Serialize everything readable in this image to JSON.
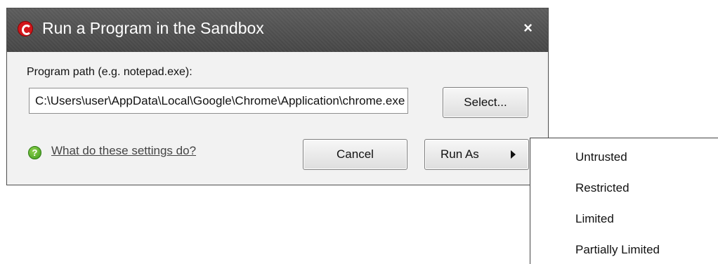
{
  "dialog": {
    "title": "Run a Program in the Sandbox",
    "close_glyph": "×",
    "program_path_label": "Program path (e.g. notepad.exe):",
    "program_path_value": "C:\\Users\\user\\AppData\\Local\\Google\\Chrome\\Application\\chrome.exe",
    "select_button": "Select...",
    "help_link": "What do these settings do?",
    "cancel_button": "Cancel",
    "run_as_button": "Run As",
    "icons": {
      "app": "comodo-icon",
      "help": "help-icon",
      "submenu": "arrow-right-icon"
    }
  },
  "run_as_menu": {
    "items": [
      "Untrusted",
      "Restricted",
      "Limited",
      "Partially Limited"
    ]
  },
  "colors": {
    "titlebar": "#4f4f4f",
    "dialog_bg": "#f2f2f2",
    "app_icon": "#d3161b",
    "help_icon": "#5bb531"
  }
}
